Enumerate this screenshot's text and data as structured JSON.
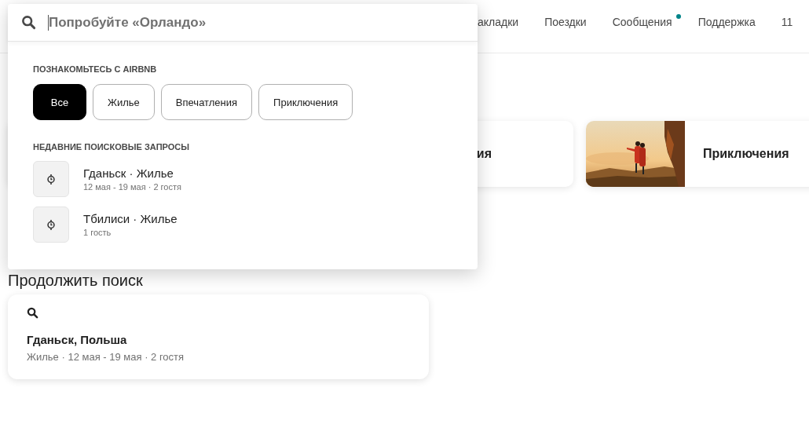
{
  "nav": [
    {
      "label": "акладки",
      "dot": false
    },
    {
      "label": "Поездки",
      "dot": false
    },
    {
      "label": "Сообщения",
      "dot": true
    },
    {
      "label": "Поддержка",
      "dot": false
    },
    {
      "label": "11",
      "dot": false
    }
  ],
  "categories": [
    {
      "label": "ия",
      "kind": "text"
    },
    {
      "label": "Приключения",
      "kind": "picture"
    }
  ],
  "continue": {
    "heading": "Продолжить поиск",
    "title": "Гданьск, Польша",
    "details": "Жилье · 12 мая - 19 мая · 2 гостя"
  },
  "search": {
    "placeholder": "Попробуйте «Орландо»",
    "explore_heading": "ПОЗНАКОМЬТЕСЬ С AIRBNB",
    "chips": [
      {
        "label": "Все",
        "selected": true
      },
      {
        "label": "Жилье",
        "selected": false
      },
      {
        "label": "Впечатления",
        "selected": false
      },
      {
        "label": "Приключения",
        "selected": false
      }
    ],
    "recent_heading": "НЕДАВНИЕ ПОИСКОВЫЕ ЗАПРОСЫ",
    "recent": [
      {
        "title": "Гданьск · Жилье",
        "details": "12 мая - 19 мая · 2 гостя"
      },
      {
        "title": "Тбилиси · Жилье",
        "details": "1 гость"
      }
    ]
  }
}
